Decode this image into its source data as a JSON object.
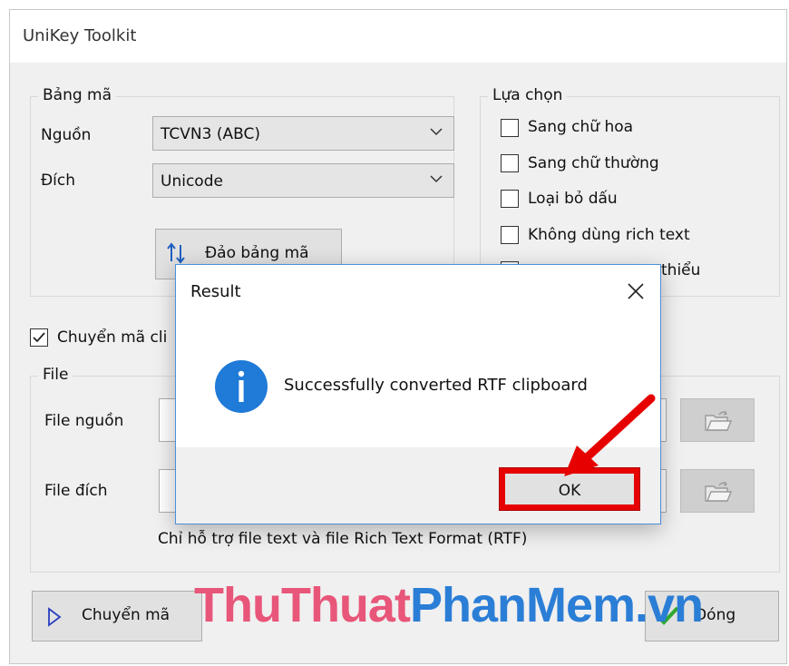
{
  "window": {
    "title": "UniKey Toolkit"
  },
  "encoding_group": {
    "legend": "Bảng mã",
    "source_label": "Nguồn",
    "source_value": "TCVN3 (ABC)",
    "target_label": "Đích",
    "target_value": "Unicode",
    "swap_button": "Đảo bảng mã"
  },
  "options_group": {
    "legend": "Lựa chọn",
    "items": [
      {
        "label": "Sang chữ hoa",
        "checked": false
      },
      {
        "label": "Sang chữ thường",
        "checked": false
      },
      {
        "label": "Loại bỏ dấu",
        "checked": false
      },
      {
        "label": "Không dùng rich text",
        "checked": false
      },
      {
        "label": "thiểu",
        "checked": false
      }
    ]
  },
  "clipboard_option": {
    "label": "Chuyển mã cli",
    "checked": true
  },
  "file_group": {
    "legend": "File",
    "source_label": "File nguồn",
    "target_label": "File đích",
    "hint": "Chỉ hỗ trợ file text và file Rich Text Format (RTF)"
  },
  "footer": {
    "convert_button": "Chuyển mã",
    "close_button": "Đóng"
  },
  "dialog": {
    "title": "Result",
    "message": "Successfully converted RTF clipboard",
    "ok_button": "OK"
  },
  "watermark": {
    "part1": "ThuThuat",
    "part2": "PhanMem.vn"
  },
  "colors": {
    "highlight": "#e60000",
    "info_icon": "#1f7ad8",
    "close_check": "#2fa82f"
  },
  "icons": [
    "chevron-down-icon",
    "swap-icon",
    "checkmark-icon",
    "folder-open-icon",
    "play-icon",
    "close-icon",
    "info-icon",
    "arrow-icon"
  ]
}
